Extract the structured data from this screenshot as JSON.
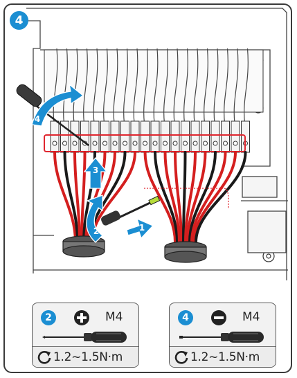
{
  "step_badge": "4",
  "callouts": {
    "c1": "1",
    "c2": "2",
    "c3": "3",
    "c4": "4"
  },
  "cards": [
    {
      "step": "2",
      "screw_type_icon": "phillips-plus-icon",
      "size": "M4",
      "torque": "1.2~1.5N·m"
    },
    {
      "step": "4",
      "screw_type_icon": "flat-minus-icon",
      "size": "M4",
      "torque": "1.2~1.5N·m"
    }
  ],
  "colors": {
    "accent_blue": "#1b8ed2",
    "cable_red": "#d41f1f",
    "cable_black": "#1a1a1a",
    "highlight_red": "#e0262f"
  }
}
